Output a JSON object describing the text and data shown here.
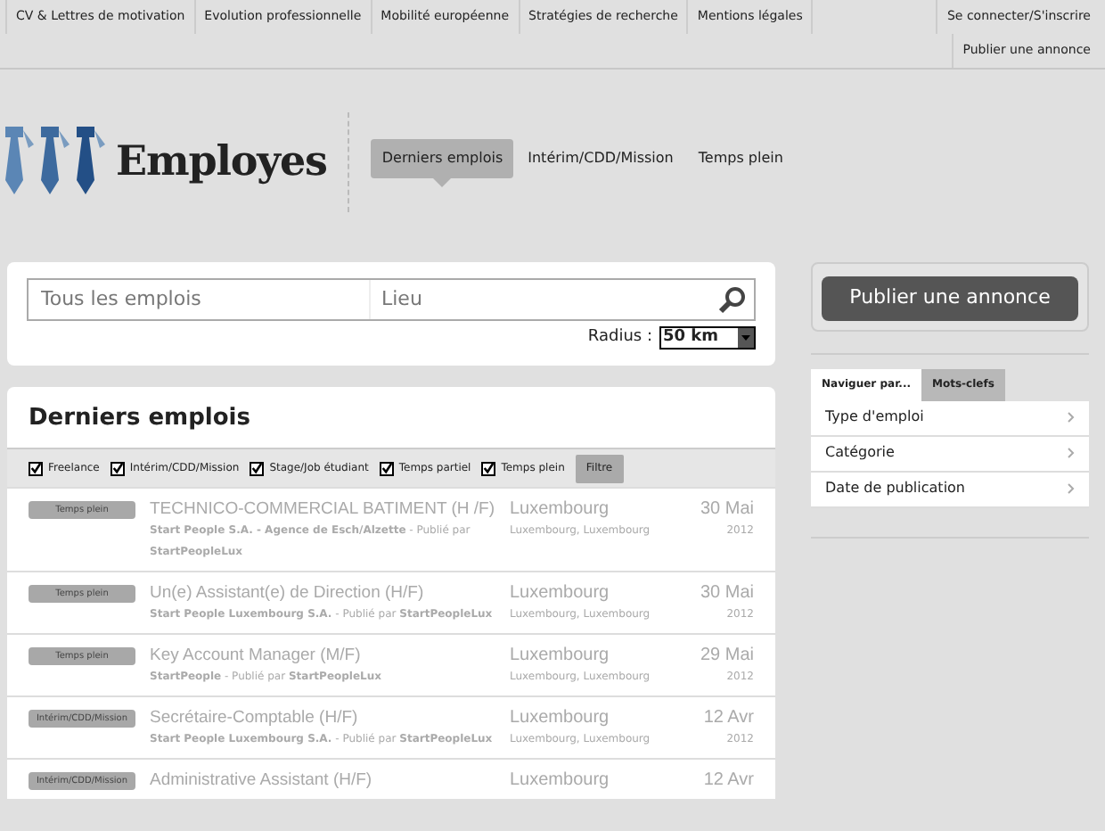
{
  "top_nav": {
    "links": [
      "CV & Lettres de motivation",
      "Evolution professionnelle",
      "Mobilité européenne",
      "Stratégies de recherche",
      "Mentions légales"
    ],
    "account_links": [
      "Se connecter/S'inscrire",
      "Publier une annonce"
    ]
  },
  "logo": {
    "text": "Employes"
  },
  "main_tabs": [
    {
      "label": "Derniers emplois",
      "selected": true
    },
    {
      "label": "Intérim/CDD/Mission",
      "selected": false
    },
    {
      "label": "Temps plein",
      "selected": false
    }
  ],
  "search": {
    "keyword_placeholder": "Tous les emplois",
    "location_placeholder": "Lieu",
    "radius_label": "Radius :",
    "radius_value": "50 km"
  },
  "jobs": {
    "title": "Derniers emplois",
    "filters": [
      {
        "label": "Freelance",
        "checked": true
      },
      {
        "label": "Intérim/CDD/Mission",
        "checked": true
      },
      {
        "label": "Stage/Job étudiant",
        "checked": true
      },
      {
        "label": "Temps partiel",
        "checked": true
      },
      {
        "label": "Temps plein",
        "checked": true
      }
    ],
    "filter_button": "Filtre",
    "rows": [
      {
        "type": "Temps plein",
        "title": "TECHNICO-COMMERCIAL BATIMENT (H /F)",
        "meta": "**Start People S.A. - Agence de Esch/Alzette** - Publié par **StartPeopleLux**",
        "city": "Luxembourg",
        "region": "Luxembourg, Luxembourg",
        "day": "30 Mai",
        "year": "2012"
      },
      {
        "type": "Temps plein",
        "title": "Un(e) Assistant(e) de Direction (H/F)",
        "meta": "**Start People Luxembourg S.A.** - Publié par **StartPeopleLux**",
        "city": "Luxembourg",
        "region": "Luxembourg, Luxembourg",
        "day": "30 Mai",
        "year": "2012"
      },
      {
        "type": "Temps plein",
        "title": "Key Account Manager (M/F)",
        "meta": "**StartPeople** - Publié par **StartPeopleLux**",
        "city": "Luxembourg",
        "region": "Luxembourg, Luxembourg",
        "day": "29 Mai",
        "year": "2012"
      },
      {
        "type": "Intérim/CDD/Mission",
        "title": "Secrétaire-Comptable (H/F)",
        "meta": "**Start People Luxembourg S.A.** - Publié par **StartPeopleLux**",
        "city": "Luxembourg",
        "region": "Luxembourg, Luxembourg",
        "day": "12 Avr",
        "year": "2012"
      },
      {
        "type": "Intérim/CDD/Mission",
        "title": "Administrative Assistant (H/F)",
        "city": "Luxembourg",
        "day": "12 Avr"
      }
    ]
  },
  "sidebar": {
    "publish_button": "Publier une annonce",
    "tabs": [
      {
        "label": "Naviguer par...",
        "selected": true
      },
      {
        "label": "Mots-clefs",
        "selected": false
      }
    ],
    "items": [
      "Type d'emploi",
      "Catégorie",
      "Date de publication"
    ]
  }
}
